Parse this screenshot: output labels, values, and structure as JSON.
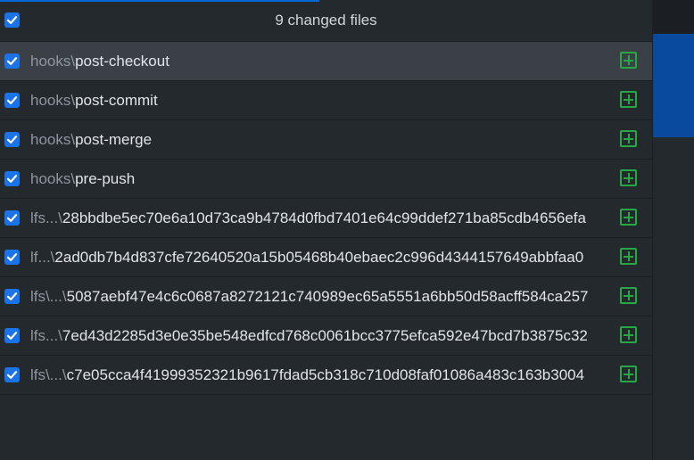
{
  "header": {
    "title": "9 changed files",
    "select_all_checked": true
  },
  "files": [
    {
      "dir": "hooks\\",
      "name": "post-checkout",
      "checked": true,
      "selected": true,
      "status": "added"
    },
    {
      "dir": "hooks\\",
      "name": "post-commit",
      "checked": true,
      "selected": false,
      "status": "added"
    },
    {
      "dir": "hooks\\",
      "name": "post-merge",
      "checked": true,
      "selected": false,
      "status": "added"
    },
    {
      "dir": "hooks\\",
      "name": "pre-push",
      "checked": true,
      "selected": false,
      "status": "added"
    },
    {
      "dir": "lfs...\\",
      "name": "28bbdbe5ec70e6a10d73ca9b4784d0fbd7401e64c99ddef271ba85cdb4656efa",
      "checked": true,
      "selected": false,
      "status": "added"
    },
    {
      "dir": "lf...\\",
      "name": "2ad0db7b4d837cfe72640520a15b05468b40ebaec2c996d4344157649abbfaa0",
      "checked": true,
      "selected": false,
      "status": "added"
    },
    {
      "dir": "lfs\\...\\",
      "name": "5087aebf47e4c6c0687a8272121c740989ec65a5551a6bb50d58acff584ca257",
      "checked": true,
      "selected": false,
      "status": "added"
    },
    {
      "dir": "lfs...\\",
      "name": "7ed43d2285d3e0e35be548edfcd768c0061bcc3775efca592e47bcd7b3875c32",
      "checked": true,
      "selected": false,
      "status": "added"
    },
    {
      "dir": "lfs\\...\\",
      "name": "c7e05cca4f41999352321b9617fdad5cb318c710d08faf01086a483c163b3004",
      "checked": true,
      "selected": false,
      "status": "added"
    }
  ],
  "icons": {
    "checkbox": "checkbox-checked-icon",
    "status_added": "plus-square-icon"
  },
  "colors": {
    "background": "#24292e",
    "selected_row": "#3a4046",
    "checkbox": "#1a73e8",
    "added": "#28a745",
    "dir_text": "#8f969c",
    "file_text": "#e1e4e8"
  }
}
